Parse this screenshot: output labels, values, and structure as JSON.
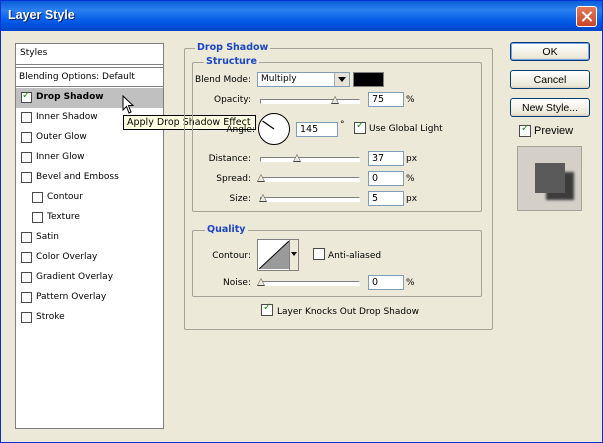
{
  "window": {
    "title": "Layer Style"
  },
  "styles_list": {
    "header": "Styles",
    "blending": "Blending Options: Default",
    "items": [
      {
        "label": "Drop Shadow",
        "checked": true,
        "selected": true,
        "indent": false
      },
      {
        "label": "Inner Shadow",
        "checked": false,
        "selected": false,
        "indent": false
      },
      {
        "label": "Outer Glow",
        "checked": false,
        "selected": false,
        "indent": false
      },
      {
        "label": "Inner Glow",
        "checked": false,
        "selected": false,
        "indent": false
      },
      {
        "label": "Bevel and Emboss",
        "checked": false,
        "selected": false,
        "indent": false
      },
      {
        "label": "Contour",
        "checked": false,
        "selected": false,
        "indent": true
      },
      {
        "label": "Texture",
        "checked": false,
        "selected": false,
        "indent": true
      },
      {
        "label": "Satin",
        "checked": false,
        "selected": false,
        "indent": false
      },
      {
        "label": "Color Overlay",
        "checked": false,
        "selected": false,
        "indent": false
      },
      {
        "label": "Gradient Overlay",
        "checked": false,
        "selected": false,
        "indent": false
      },
      {
        "label": "Pattern Overlay",
        "checked": false,
        "selected": false,
        "indent": false
      },
      {
        "label": "Stroke",
        "checked": false,
        "selected": false,
        "indent": false
      }
    ]
  },
  "tooltip": "Apply Drop Shadow Effect",
  "drop_shadow": {
    "title": "Drop Shadow",
    "structure": {
      "title": "Structure",
      "blend_mode_label": "Blend Mode:",
      "blend_mode_value": "Multiply",
      "color": "#000000",
      "opacity_label": "Opacity:",
      "opacity_value": "75",
      "opacity_unit": "%",
      "opacity_fraction": 0.75,
      "angle_label": "Angle:",
      "angle_value": "145",
      "angle_unit": "°",
      "use_global_light_label": "Use Global Light",
      "use_global_light": true,
      "distance_label": "Distance:",
      "distance_value": "37",
      "distance_unit": "px",
      "distance_fraction": 0.37,
      "spread_label": "Spread:",
      "spread_value": "0",
      "spread_unit": "%",
      "spread_fraction": 0,
      "size_label": "Size:",
      "size_value": "5",
      "size_unit": "px",
      "size_fraction": 0.02
    },
    "quality": {
      "title": "Quality",
      "contour_label": "Contour:",
      "anti_aliased_label": "Anti-aliased",
      "anti_aliased": false,
      "noise_label": "Noise:",
      "noise_value": "0",
      "noise_unit": "%",
      "noise_fraction": 0
    },
    "knocks_out_label": "Layer Knocks Out Drop Shadow",
    "knocks_out": true
  },
  "buttons": {
    "ok": "OK",
    "cancel": "Cancel",
    "new_style": "New Style..."
  },
  "preview": {
    "label": "Preview",
    "checked": true
  }
}
